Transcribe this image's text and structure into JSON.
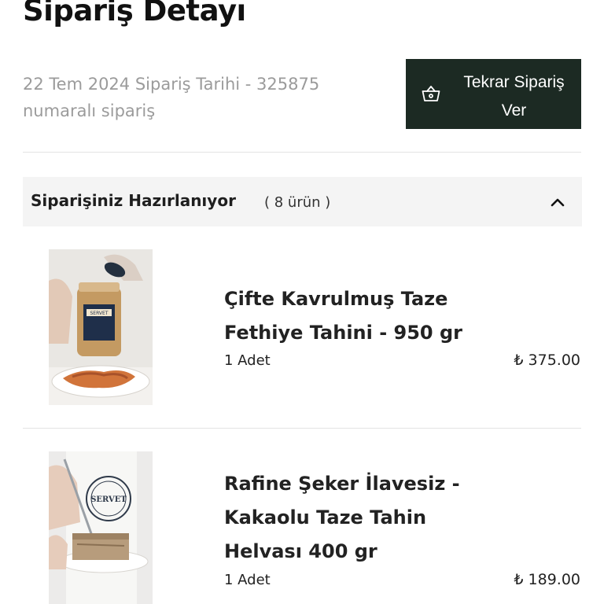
{
  "page": {
    "title": "Sipariş Detayı",
    "order_info": "22 Tem 2024 Sipariş Tarihi - 325875 numaralı sipariş"
  },
  "reorder_button": {
    "label": "Tekrar Sipariş Ver",
    "icon": "basket-icon"
  },
  "status": {
    "title": "Siparişiniz Hazırlanıyor",
    "count": "( 8 ürün )",
    "icon": "chevron-up-icon"
  },
  "products": [
    {
      "name": "Çifte Kavrulmuş Taze Fethiye Tahini - 950 gr",
      "quantity": "1 Adet",
      "price": "₺ 375.00",
      "label_text": "SERVET"
    },
    {
      "name": "Rafine Şeker İlavesiz - Kakaolu Taze Tahin Helvası 400 gr",
      "quantity": "1 Adet",
      "price": "₺ 189.00",
      "label_text": "SERVET"
    }
  ],
  "colors": {
    "button_bg": "#1c2a23",
    "status_bg": "#f4f4f4",
    "muted_text": "#9b9b9b"
  }
}
